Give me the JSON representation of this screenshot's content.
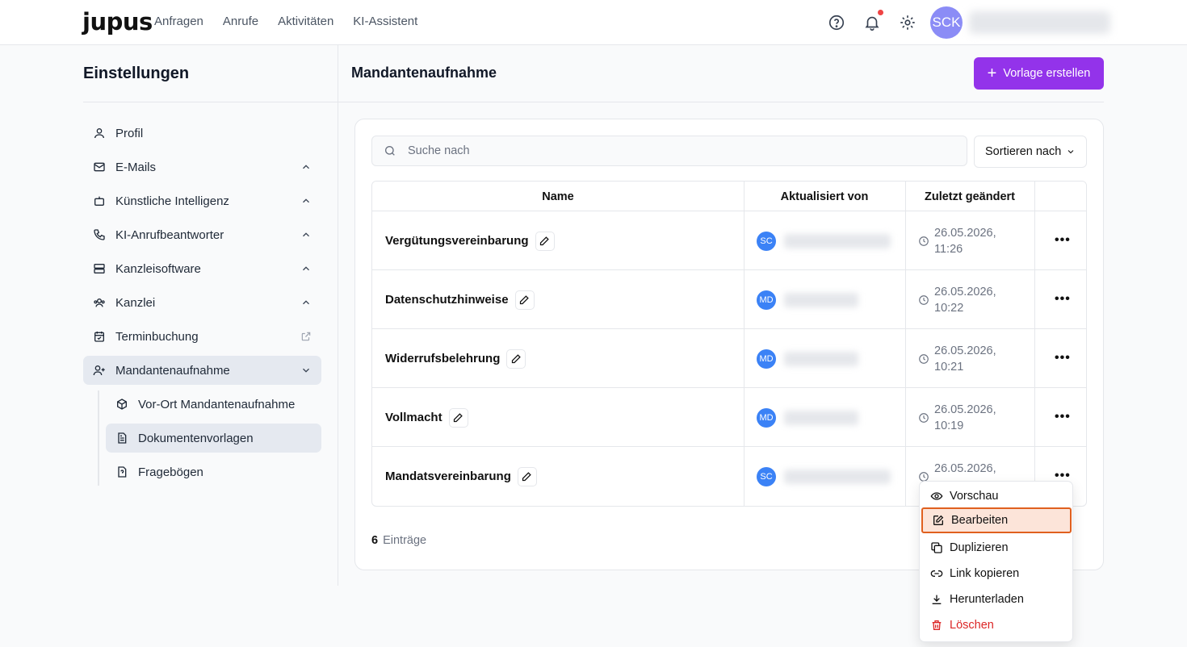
{
  "app": {
    "logo": "jupus",
    "avatar_initials": "SCK"
  },
  "nav": [
    "Anfragen",
    "Anrufe",
    "Aktivitäten",
    "KI-Assistent"
  ],
  "sidebar": {
    "title": "Einstellungen",
    "items": [
      {
        "label": "Profil"
      },
      {
        "label": "E-Mails"
      },
      {
        "label": "Künstliche Intelligenz"
      },
      {
        "label": "KI-Anrufbeantworter"
      },
      {
        "label": "Kanzleisoftware"
      },
      {
        "label": "Kanzlei"
      },
      {
        "label": "Terminbuchung"
      },
      {
        "label": "Mandantenaufnahme"
      }
    ],
    "sub_items": [
      {
        "label": "Vor-Ort Mandantenaufnahme"
      },
      {
        "label": "Dokumentenvorlagen"
      },
      {
        "label": "Fragebögen"
      }
    ]
  },
  "main": {
    "title": "Mandantenaufnahme",
    "create_label": "Vorlage erstellen",
    "search_placeholder": "Suche nach",
    "sort_label": "Sortieren nach",
    "columns": [
      "Name",
      "Aktualisiert von",
      "Zuletzt geändert"
    ],
    "rows": [
      {
        "name": "Vergütungsvereinbarung",
        "user": "SC",
        "date": "26.05.2026,",
        "time": "11:26"
      },
      {
        "name": "Datenschutzhinweise",
        "user": "MD",
        "date": "26.05.2026,",
        "time": "10:22"
      },
      {
        "name": "Widerrufsbelehrung",
        "user": "MD",
        "date": "26.05.2026,",
        "time": "10:21"
      },
      {
        "name": "Vollmacht",
        "user": "MD",
        "date": "26.05.2026,",
        "time": "10:19"
      },
      {
        "name": "Mandatsvereinbarung",
        "user": "SC",
        "date": "26.05.2026,",
        "time": ""
      }
    ],
    "count": "6",
    "count_label": "Einträge"
  },
  "menu": {
    "items": [
      {
        "label": "Vorschau",
        "icon": "eye-icon"
      },
      {
        "label": "Bearbeiten",
        "icon": "edit-icon"
      },
      {
        "label": "Duplizieren",
        "icon": "copy-icon"
      },
      {
        "label": "Link kopieren",
        "icon": "link-icon"
      },
      {
        "label": "Herunterladen",
        "icon": "download-icon"
      },
      {
        "label": "Löschen",
        "icon": "trash-icon"
      }
    ]
  },
  "colors": {
    "accent": "#9333ea",
    "highlight_border": "#e0601f",
    "danger": "#dc2626",
    "avatar": "#3b82f6"
  }
}
